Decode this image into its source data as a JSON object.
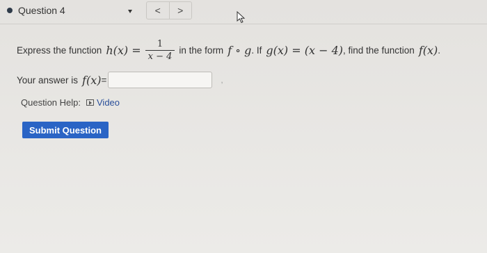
{
  "header": {
    "question_label": "Question 4",
    "prev_label": "<",
    "next_label": ">"
  },
  "problem": {
    "intro": "Express the function",
    "h_lhs": "h(x) =",
    "frac_num": "1",
    "frac_den": "x − 4",
    "middle": "in the form",
    "composition": "f ∘ g",
    "if_text": ". If",
    "g_expr": "g(x) = (x − 4)",
    "find_text": ", find the function",
    "f_expr": "f(x)",
    "end": "."
  },
  "answer": {
    "prefix": "Your answer is",
    "f_label": "f(x)",
    "equals": "=",
    "value": "",
    "trailing": ","
  },
  "help": {
    "label": "Question Help:",
    "video_label": "Video"
  },
  "submit": {
    "label": "Submit Question"
  },
  "icons": {
    "status": "dot-icon",
    "dropdown": "caret-down-icon",
    "video": "video-icon",
    "cursor": "cursor-icon"
  }
}
